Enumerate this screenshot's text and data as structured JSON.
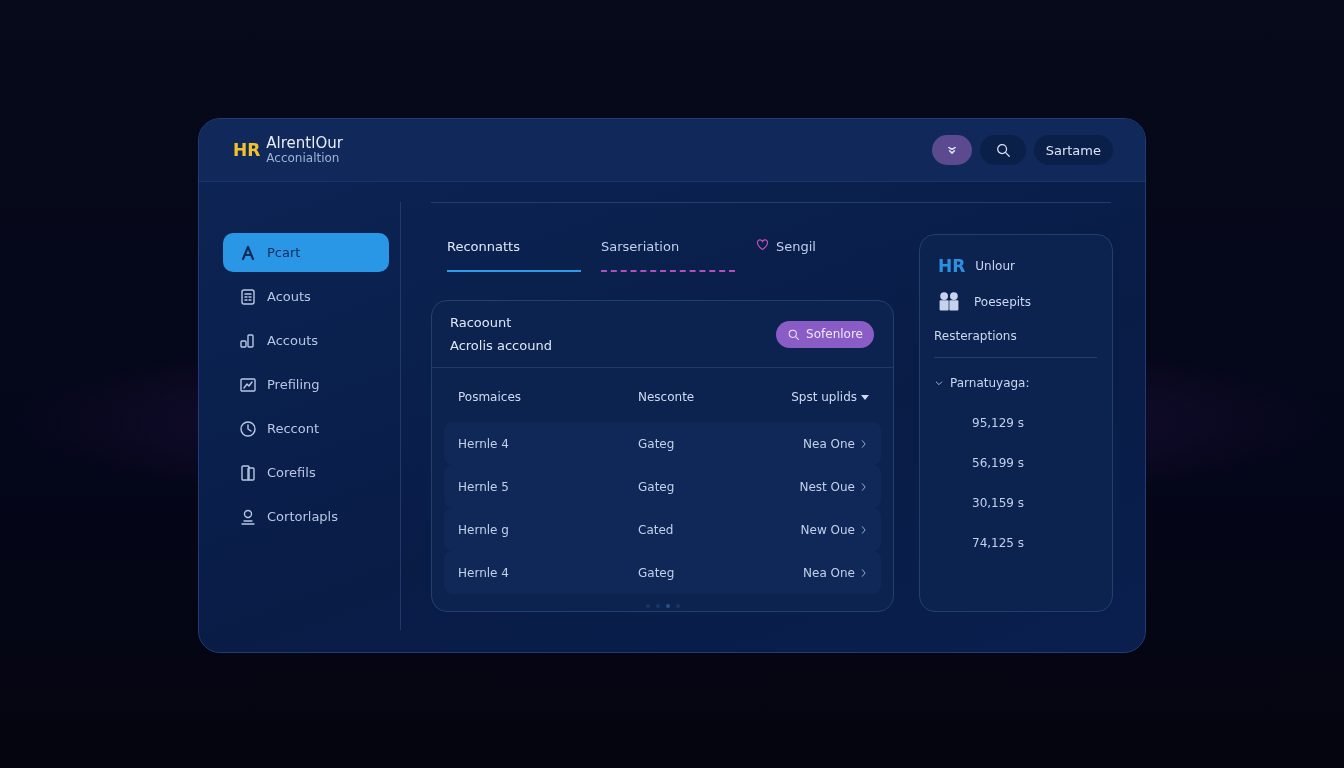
{
  "header": {
    "logo": "HR",
    "title": "AlrentlOur",
    "subtitle": "Acconialtion",
    "user_button": "Sartame"
  },
  "sidebar": {
    "items": [
      {
        "label": "Pcart",
        "selected": true
      },
      {
        "label": "Acouts",
        "selected": false
      },
      {
        "label": "Accouts",
        "selected": false
      },
      {
        "label": "Prefiling",
        "selected": false
      },
      {
        "label": "Reccont",
        "selected": false
      },
      {
        "label": "Corefils",
        "selected": false
      },
      {
        "label": "Cortorlapls",
        "selected": false
      }
    ]
  },
  "tabs": [
    {
      "label": "Reconnatts",
      "selected": true,
      "color": "#2f9be8"
    },
    {
      "label": "Sarseriation",
      "selected": false,
      "color": "#b04fc0"
    },
    {
      "label": "Sengil",
      "selected": false
    }
  ],
  "card": {
    "title": "Racoount",
    "subtitle": "Acrolis accound",
    "action": "Sofenlore",
    "table": {
      "columns": [
        "Posmaices",
        "Nesconte",
        "Spst uplids"
      ],
      "rows": [
        [
          "Hernle 4",
          "Gateg",
          "Nea One"
        ],
        [
          "Hernle 5",
          "Gateg",
          "Nest Oue"
        ],
        [
          "Hernle g",
          "Cated",
          "New Oue"
        ],
        [
          "Hernle 4",
          "Gateg",
          "Nea One"
        ]
      ]
    },
    "pager": [
      {
        "selected": false
      },
      {
        "selected": false
      },
      {
        "selected": true
      },
      {
        "selected": false
      }
    ]
  },
  "panel": {
    "logo": "HR",
    "title": "Unlour",
    "people": "Poesepits",
    "section": "Resteraptions",
    "group": {
      "label": "Parnatuyaga:",
      "expanded": true,
      "values": [
        "95,129 s",
        "56,199 s",
        "30,159 s",
        "74,125 s"
      ]
    }
  }
}
